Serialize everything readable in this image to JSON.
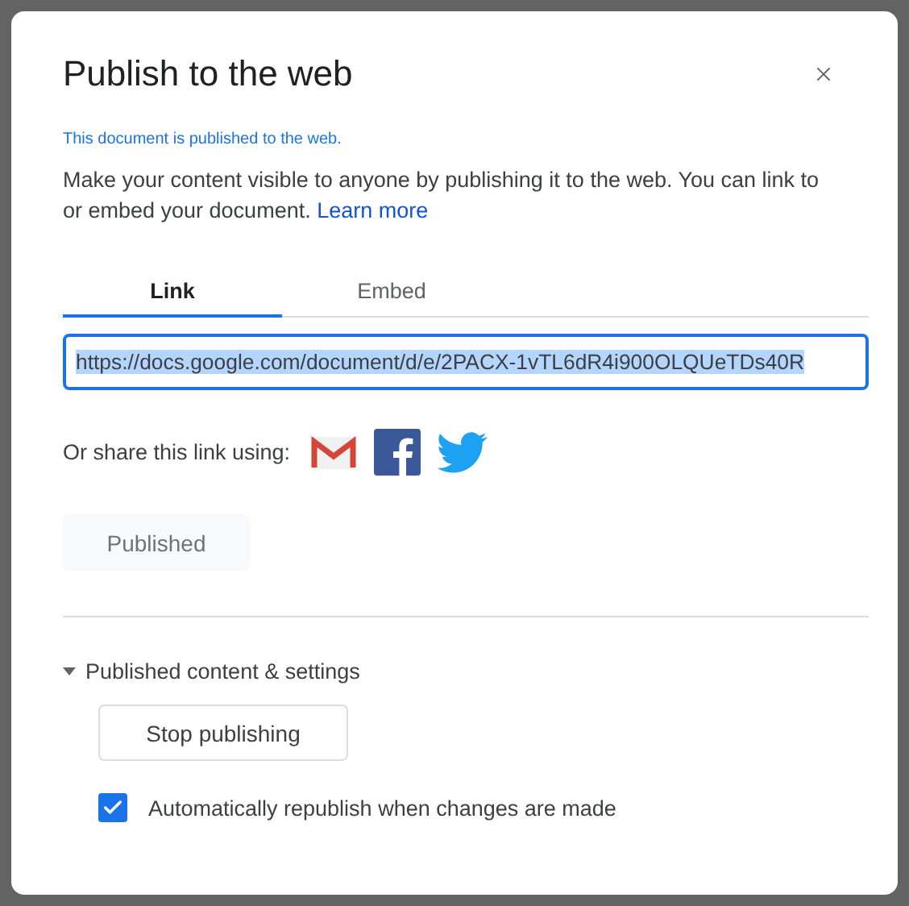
{
  "dialog": {
    "title": "Publish to the web",
    "status": "This document is published to the web.",
    "description": "Make your content visible to anyone by publishing it to the web. You can link to or embed your document.",
    "learn_more": "Learn more",
    "tabs": [
      {
        "label": "Link",
        "selected": true
      },
      {
        "label": "Embed",
        "selected": false
      }
    ],
    "link_field": {
      "value": "https://docs.google.com/document/d/e/2PACX-1vTL6dR4i900OLQUeTDs40R",
      "selected_text": true
    },
    "share_label": "Or share this link using:",
    "published_button": {
      "label": "Published",
      "disabled": true
    },
    "settings": {
      "label": "Published content & settings",
      "expanded": true,
      "stop_button": "Stop publishing",
      "auto_republish": {
        "label": "Automatically republish when changes are made",
        "checked": true
      }
    }
  }
}
